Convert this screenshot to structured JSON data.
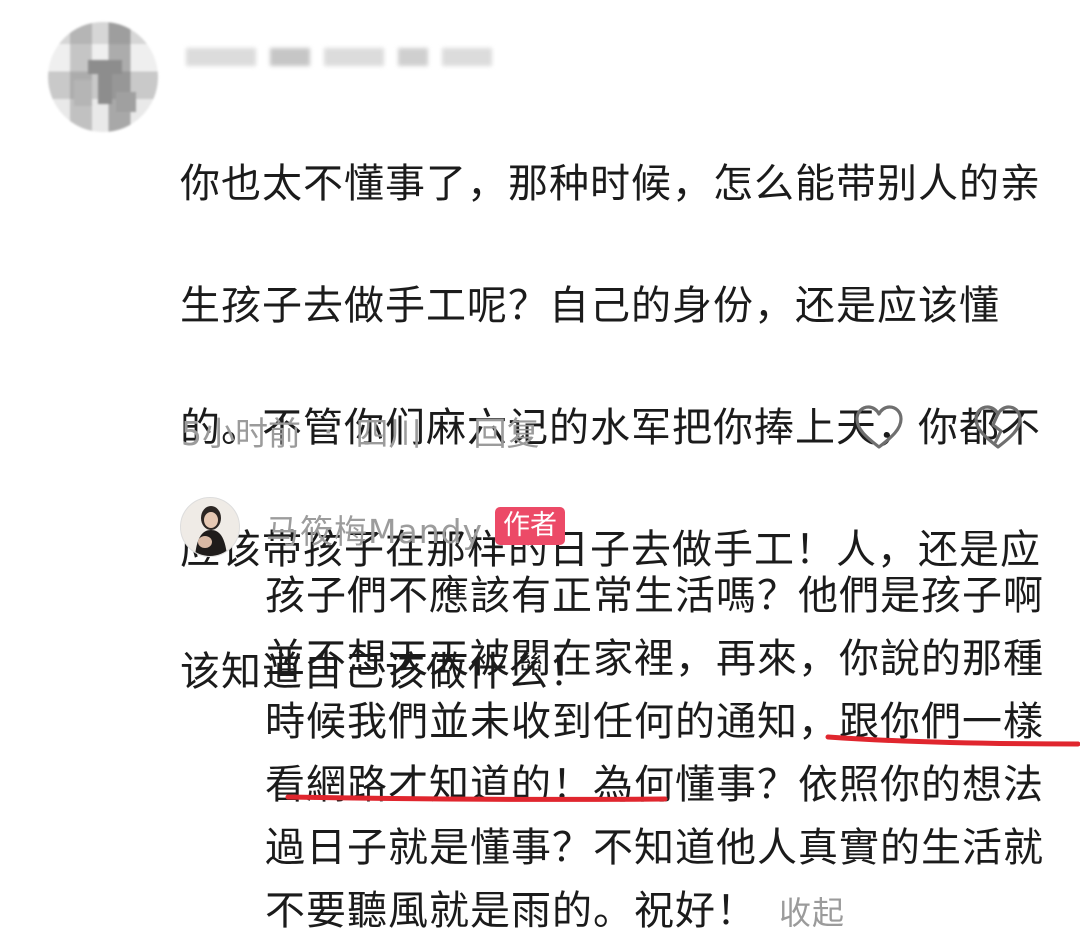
{
  "comment": {
    "lines": [
      "你也太不懂事了，那种时候，怎么能带别人的亲",
      "生孩子去做手工呢？自己的身份，还是应该懂",
      "的。不管你们麻六记的水军把你捧上天，你都不",
      "应该带孩子在那样的日子去做手工！人，还是应",
      "该知道自己该做什么！"
    ],
    "time": "5小时前",
    "separator": "·",
    "location": "四川",
    "reply_label": "回复",
    "icons": [
      "heart-outline-icon",
      "broken-heart-icon"
    ]
  },
  "reply": {
    "author_name": "马筱梅Mandy",
    "badge": "作者",
    "lines": [
      "孩子們不應該有正常生活嗎？他們是孩子啊",
      "並不想天天被關在家裡，再來，你說的那種",
      "時候我們並未收到任何的通知，跟你們一樣",
      "看網路才知道的！為何懂事？依照你的想法",
      "過日子就是懂事？不知道他人真實的生活就",
      "不要聽風就是雨的。祝好！"
    ],
    "collapse_label": "收起",
    "highlight_color": "#e0262e"
  }
}
